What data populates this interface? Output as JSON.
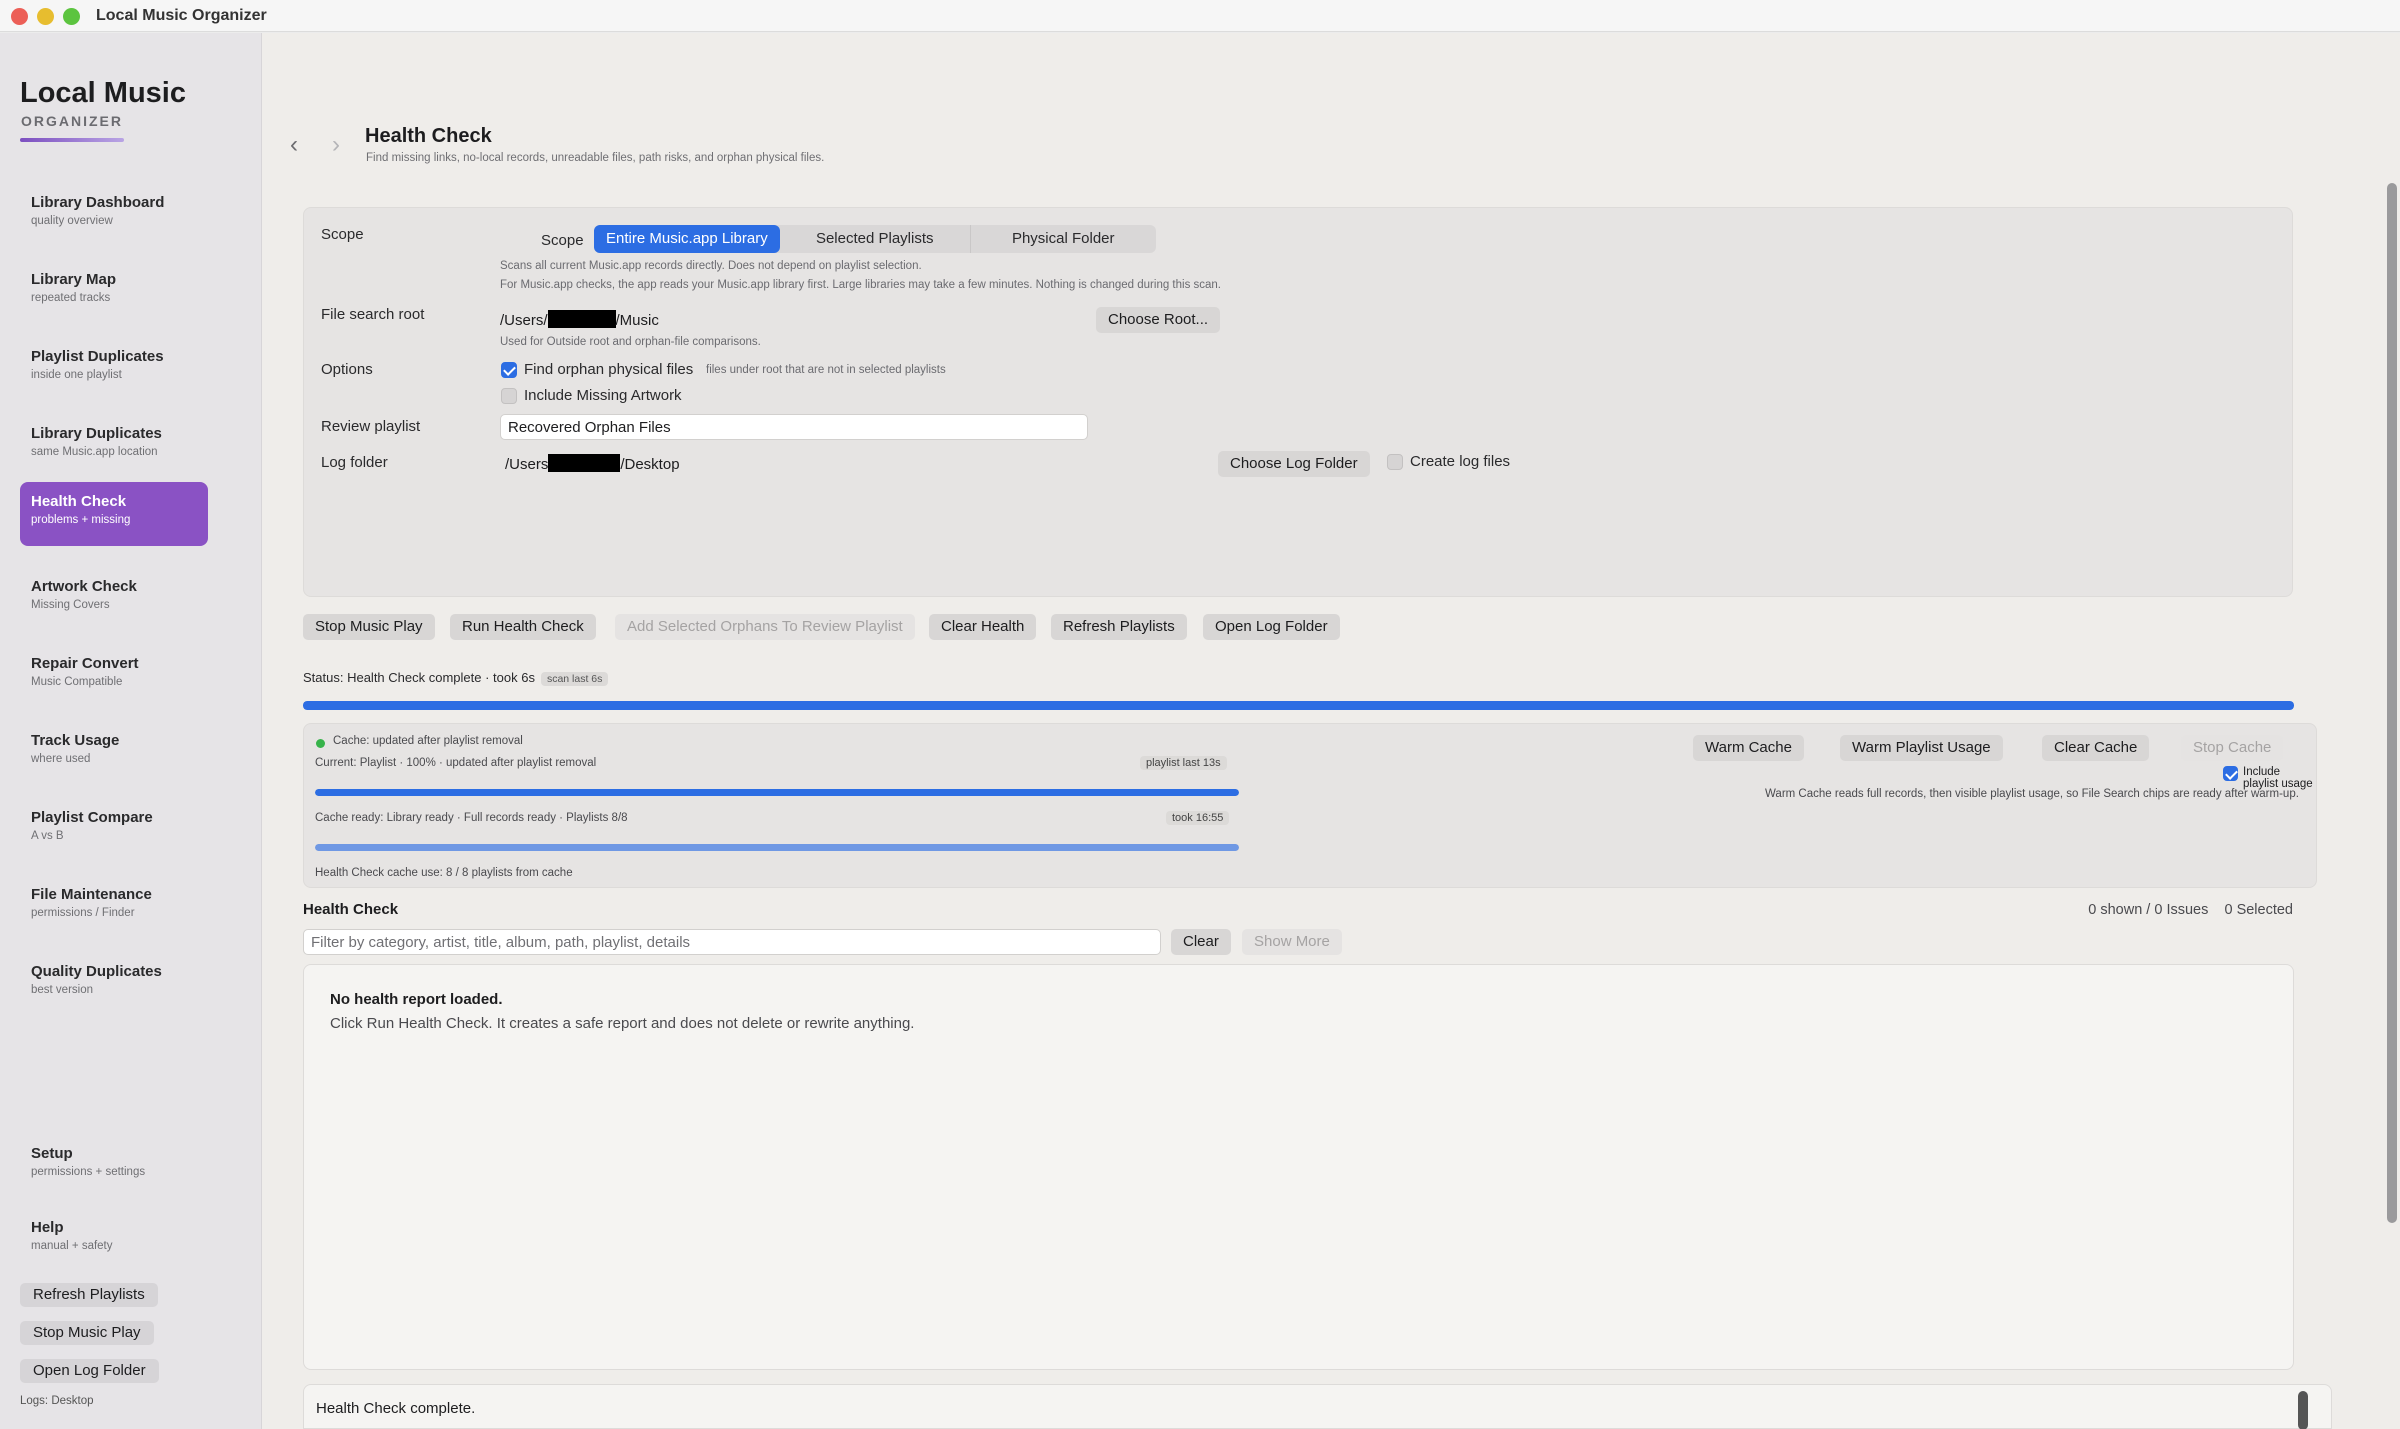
{
  "window": {
    "title": "Local Music Organizer"
  },
  "brand": {
    "title": "Local Music",
    "subtitle": "ORGANIZER"
  },
  "sidebar": {
    "items": [
      {
        "label": "Library Dashboard",
        "sub": "quality overview"
      },
      {
        "label": "Library Map",
        "sub": "repeated tracks"
      },
      {
        "label": "Playlist Duplicates",
        "sub": "inside one playlist"
      },
      {
        "label": "Library Duplicates",
        "sub": "same Music.app location"
      },
      {
        "label": "Health Check",
        "sub": "problems + missing"
      },
      {
        "label": "Artwork Check",
        "sub": "Missing Covers"
      },
      {
        "label": "Repair Convert",
        "sub": "Music Compatible"
      },
      {
        "label": "Track Usage",
        "sub": "where used"
      },
      {
        "label": "Playlist Compare",
        "sub": "A vs B"
      },
      {
        "label": "File Maintenance",
        "sub": "permissions / Finder"
      },
      {
        "label": "Quality Duplicates",
        "sub": "best version"
      },
      {
        "label": "Setup",
        "sub": "permissions + settings"
      },
      {
        "label": "Help",
        "sub": "manual + safety"
      }
    ],
    "buttons": {
      "refresh": "Refresh Playlists",
      "stop": "Stop Music Play",
      "open_log": "Open Log Folder"
    },
    "logs_note": "Logs: Desktop"
  },
  "page": {
    "title": "Health Check",
    "subtitle": "Find missing links, no-local records, unreadable files, path risks, and orphan physical files."
  },
  "settings": {
    "scope_label": "Scope",
    "scope_caption": "Scope",
    "scope_options": [
      "Entire Music.app Library",
      "Selected Playlists",
      "Physical Folder"
    ],
    "scope_help1": "Scans all current Music.app records directly. Does not depend on playlist selection.",
    "scope_help2": "For Music.app checks, the app reads your Music.app library first. Large libraries may take a few minutes. Nothing is changed during this scan.",
    "root_label": "File search root",
    "root_prefix": "/Users/",
    "root_suffix": "/Music",
    "choose_root": "Choose Root...",
    "root_help": "Used for Outside root and orphan-file comparisons.",
    "options_label": "Options",
    "opt_orphans": "Find orphan physical files",
    "opt_orphans_help": "files under root that are not in selected playlists",
    "opt_artwork": "Include Missing Artwork",
    "review_label": "Review playlist",
    "review_value": "Recovered Orphan Files",
    "log_label": "Log folder",
    "log_prefix": "/Users",
    "log_suffix": "/Desktop",
    "choose_log": "Choose Log Folder",
    "create_logs": "Create log files"
  },
  "actions": {
    "stop_music": "Stop Music Play",
    "run_health": "Run Health Check",
    "add_orphans": "Add Selected Orphans To Review Playlist",
    "clear_health": "Clear Health",
    "refresh_playlists": "Refresh Playlists",
    "open_log": "Open Log Folder"
  },
  "status": {
    "text": "Status: Health Check complete · took 6s",
    "badge": "scan last 6s",
    "progress": 1.0
  },
  "cache": {
    "state": "Cache: updated after playlist removal",
    "current": "Current: Playlist · 100% · updated after playlist removal",
    "current_badge": "playlist last 13s",
    "current_progress": 1.0,
    "ready": "Cache ready: Library ready · Full records ready · Playlists 8/8",
    "ready_badge": "took 16:55",
    "ready_progress": 1.0,
    "usage": "Health Check cache use: 8 / 8 playlists from cache",
    "warm": "Warm Cache",
    "warm_playlist": "Warm Playlist Usage",
    "clear": "Clear Cache",
    "stop": "Stop Cache",
    "include_usage": "Include playlist usage",
    "note": "Warm Cache reads full records, then visible playlist usage, so File Search chips are ready after warm-up."
  },
  "results": {
    "title": "Health Check",
    "counts": "0 shown / 0 Issues    0 Selected",
    "filter_placeholder": "Filter by category, artist, title, album, path, playlist, details",
    "clear": "Clear",
    "show_more": "Show More",
    "empty_title": "No health report loaded.",
    "empty_body": "Click Run Health Check. It creates a safe report and does not delete or rewrite anything."
  },
  "log": {
    "text": "Health Check complete."
  },
  "colors": {
    "accent": "#2c6de3",
    "brand_purple": "#8a52c4",
    "cache_ok": "#37b34a"
  }
}
